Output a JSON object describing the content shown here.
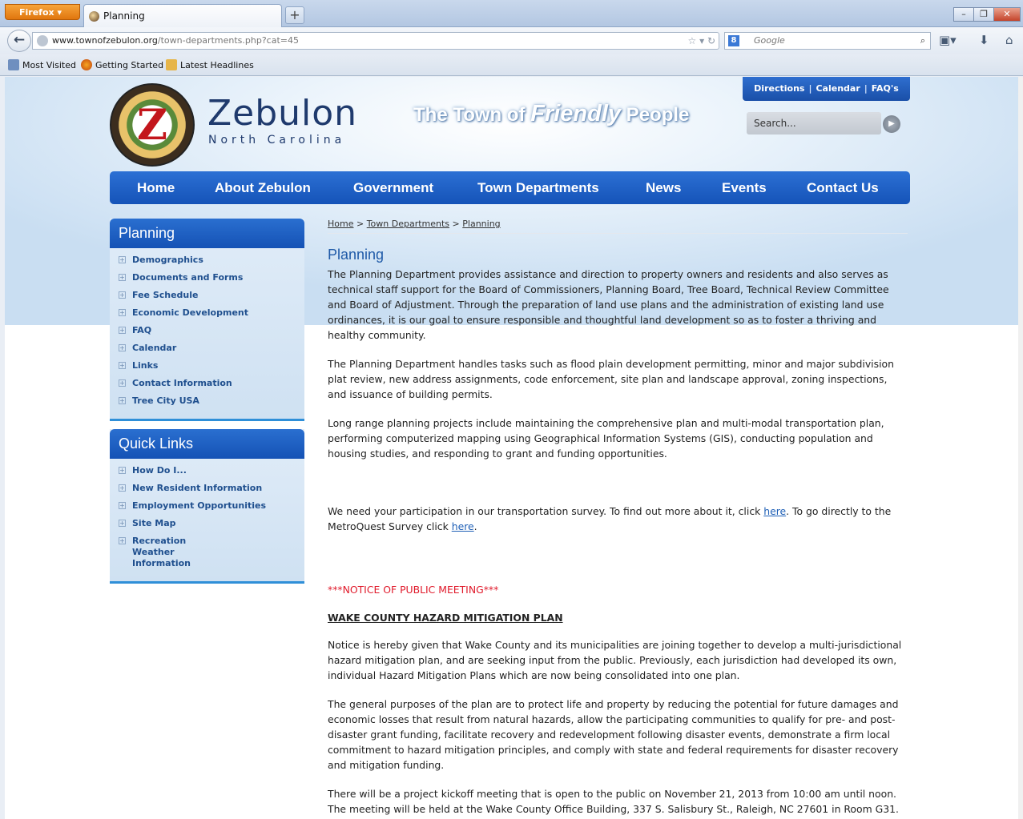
{
  "browser": {
    "menu_button": "Firefox",
    "tab_title": "Planning",
    "new_tab": "+",
    "url_host": "www.townofzebulon.org",
    "url_path": "/town-departments.php?cat=45",
    "search_engine": "Google",
    "bookmarks": [
      "Most Visited",
      "Getting Started",
      "Latest Headlines"
    ]
  },
  "site": {
    "name": "Zebulon",
    "subtitle": "North Carolina",
    "tagline_pre": "The Town of ",
    "tagline_em": "Friendly",
    "tagline_post": " People",
    "top_links": [
      "Directions",
      "Calendar",
      "FAQ's"
    ],
    "search_placeholder": "Search...",
    "nav": [
      "Home",
      "About Zebulon",
      "Government",
      "Town Departments",
      "News",
      "Events",
      "Contact Us"
    ],
    "brand_color": "#1a5cc0"
  },
  "sidebar": {
    "planning": {
      "title": "Planning",
      "items": [
        "Demographics",
        "Documents and Forms",
        "Fee Schedule",
        "Economic Development",
        "FAQ",
        "Calendar",
        "Links",
        "Contact Information",
        "Tree City USA"
      ]
    },
    "quick_links": {
      "title": "Quick Links",
      "items": [
        "How Do I...",
        "New Resident Information",
        "Employment Opportunities",
        "Site Map",
        "Recreation Weather Information"
      ]
    }
  },
  "content": {
    "breadcrumb": [
      "Home",
      "Town Departments",
      "Planning"
    ],
    "title": "Planning",
    "p1": "The Planning Department provides assistance and direction to property owners and residents and also serves as technical staff support for the Board of Commissioners, Planning Board, Tree Board, Technical Review Committee and Board of Adjustment. Through the preparation of land use plans and the administration of existing land use ordinances, it is our goal to ensure responsible and thoughtful land development so as to foster a thriving and healthy community.",
    "p2": "The Planning Department handles tasks such as flood plain development permitting, minor and major subdivision plat review, new address assignments, code enforcement, site plan and landscape approval, zoning inspections, and issuance of building permits.",
    "p3": "Long range planning projects include maintaining the comprehensive plan and multi-modal transportation plan, performing computerized mapping using Geographical Information Systems (GIS), conducting population and housing studies, and responding to grant and funding opportunities.",
    "survey_a": "We need your participation in our transportation survey. To find out more about it, click ",
    "survey_link1": "here",
    "survey_b": ". To go directly to the MetroQuest Survey click ",
    "survey_link2": "here",
    "survey_c": ".",
    "notice": "***NOTICE OF PUBLIC MEETING***",
    "plan_title": "WAKE COUNTY HAZARD MITIGATION PLAN",
    "p4": "Notice is hereby given that Wake County and its municipalities are joining together to develop a multi-jurisdictional hazard mitigation plan, and are seeking input from the public. Previously, each jurisdiction had developed its own, individual Hazard Mitigation Plans which are now being consolidated into one plan.",
    "p5": "The general purposes of the plan are to protect life and property by reducing the potential for future damages and economic losses that result from natural hazards, allow the participating communities to qualify for pre- and post-disaster grant funding, facilitate recovery and redevelopment following disaster events, demonstrate a firm local commitment to hazard mitigation principles, and comply with state and federal requirements for disaster recovery and mitigation funding.",
    "p6": "There will be a project kickoff meeting that is open to the public on November 21, 2013 from 10:00 am until noon. The meeting will be held at the Wake County Office Building, 337 S. Salisbury St., Raleigh, NC 27601 in Room G31."
  }
}
